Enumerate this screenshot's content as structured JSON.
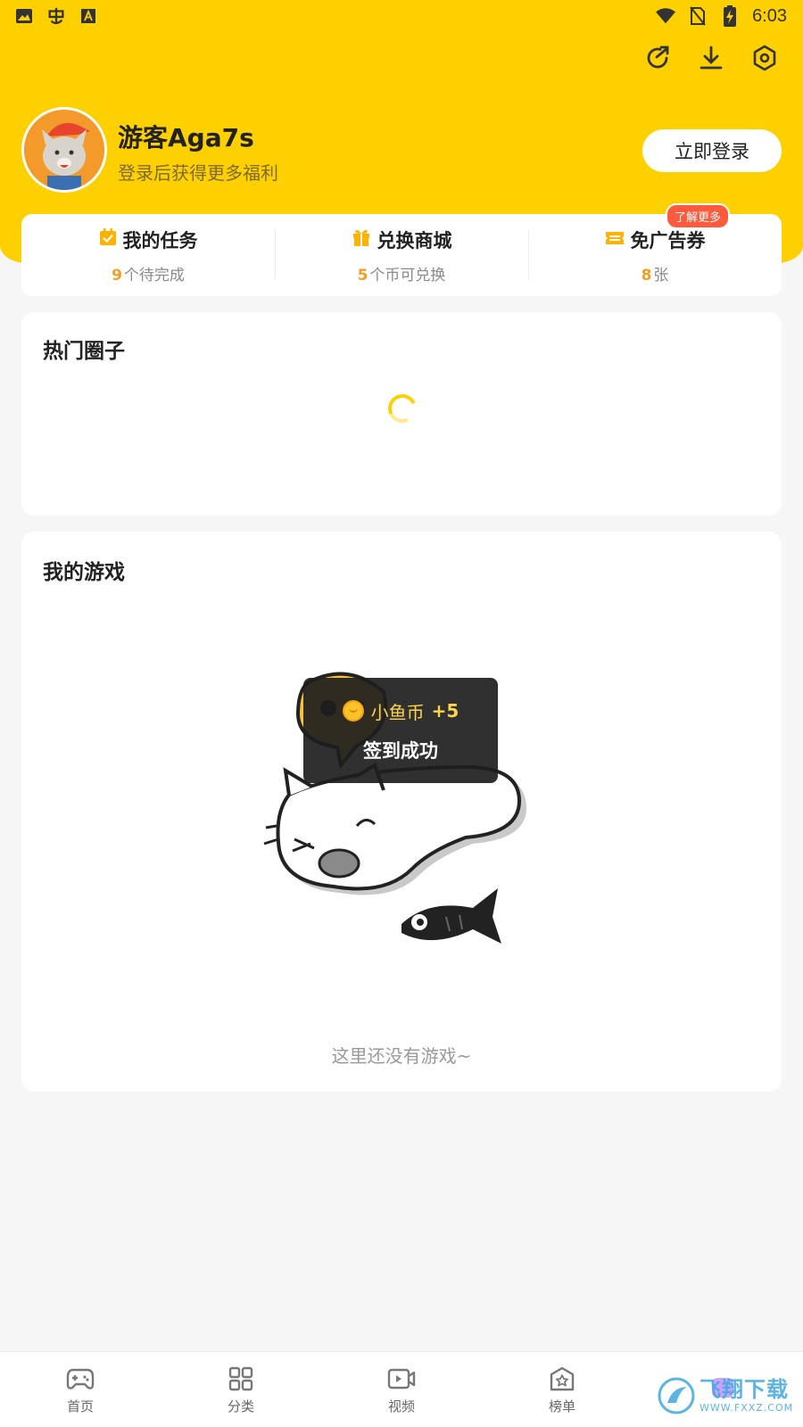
{
  "status_bar": {
    "time": "6:03",
    "left_icons": [
      "image-icon",
      "bug-app-icon",
      "a-box-icon"
    ],
    "right_icons": [
      "wifi-icon",
      "no-sim-icon",
      "battery-charging-icon"
    ]
  },
  "top_actions": [
    "share-refresh-icon",
    "download-icon",
    "settings-icon"
  ],
  "profile": {
    "username": "游客Aga7s",
    "subtitle": "登录后获得更多福利",
    "login_button": "立即登录"
  },
  "stats": [
    {
      "icon": "task-icon",
      "title": "我的任务",
      "num": "9",
      "suffix": "个待完成"
    },
    {
      "icon": "gift-icon",
      "title": "兑换商城",
      "num": "5",
      "suffix": "个币可兑换"
    },
    {
      "icon": "ticket-icon",
      "title": "免广告券",
      "num": "8",
      "suffix": "张",
      "badge": "了解更多"
    }
  ],
  "hot_circles": {
    "title": "热门圈子"
  },
  "my_games": {
    "title": "我的游戏",
    "empty_text": "这里还没有游戏~"
  },
  "toast": {
    "coin_label": "小鱼币",
    "amount": "+5",
    "message": "签到成功"
  },
  "bottom_nav": [
    {
      "icon": "gamepad-icon",
      "label": "首页"
    },
    {
      "icon": "grid-icon",
      "label": "分类"
    },
    {
      "icon": "video-icon",
      "label": "视频"
    },
    {
      "icon": "ranking-icon",
      "label": "榜单"
    },
    {
      "icon": "profile-icon",
      "label": ""
    }
  ],
  "watermark": {
    "main": "飞翔下载",
    "sub": "WWW.FXXZ.COM"
  },
  "colors": {
    "brand": "#ffd000",
    "accent_number": "#f0a020",
    "badge": "#ff5a3c"
  }
}
